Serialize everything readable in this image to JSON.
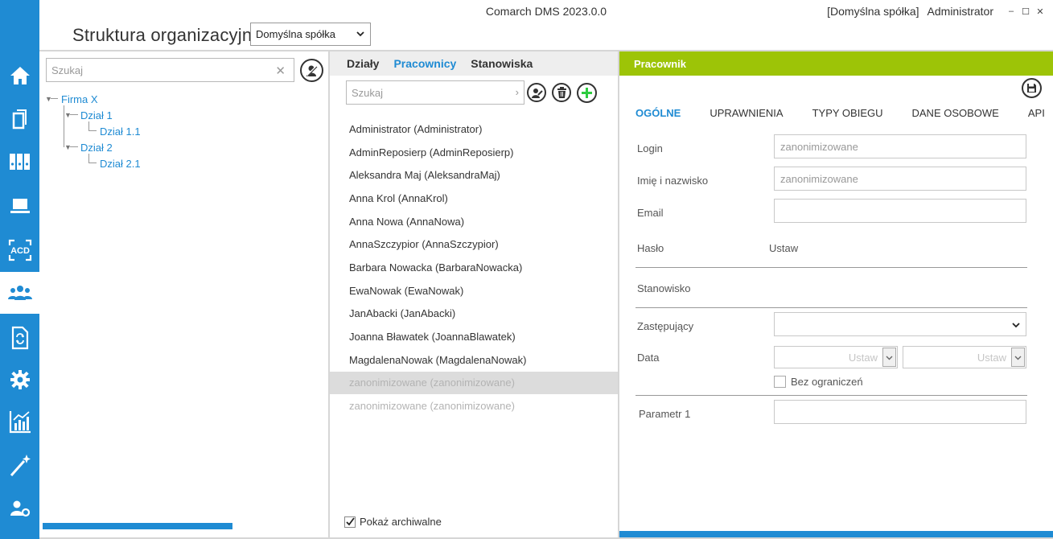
{
  "app": {
    "title": "Comarch DMS 2023.0.0",
    "company_label": "[Domyślna spółka]",
    "user": "Administrator"
  },
  "window_controls": {
    "minimize": "–",
    "maximize": "☐",
    "close": "✕"
  },
  "nav": {
    "items": [
      {
        "icon": "home-icon"
      },
      {
        "icon": "documents-icon"
      },
      {
        "icon": "binders-icon"
      },
      {
        "icon": "laptop-icon"
      },
      {
        "icon": "acd-icon",
        "label": "ACD"
      },
      {
        "icon": "users-icon",
        "active": true
      },
      {
        "icon": "document-workflow-icon"
      },
      {
        "icon": "gear-icon"
      },
      {
        "icon": "report-chart-icon"
      },
      {
        "icon": "magic-wand-icon"
      },
      {
        "icon": "user-settings-icon"
      }
    ]
  },
  "header": {
    "title": "Struktura organizacyjna",
    "company_select": "Domyślna spółka"
  },
  "left_panel": {
    "search_placeholder": "Szukaj",
    "tree": [
      {
        "label": "Firma X",
        "level": 0
      },
      {
        "label": "Dział 1",
        "level": 1
      },
      {
        "label": "Dział 1.1",
        "level": 2
      },
      {
        "label": "Dział 2",
        "level": 1
      },
      {
        "label": "Dział 2.1",
        "level": 2
      }
    ]
  },
  "mid_panel": {
    "tabs": [
      "Działy",
      "Pracownicy",
      "Stanowiska"
    ],
    "active_tab": "Pracownicy",
    "search_placeholder": "Szukaj",
    "employees": [
      "Administrator (Administrator)",
      "AdminReposierp (AdminReposierp)",
      "Aleksandra Maj (AleksandraMaj)",
      "Anna Krol (AnnaKrol)",
      "Anna Nowa (AnnaNowa)",
      "AnnaSzczypior (AnnaSzczypior)",
      "Barbara Nowacka (BarbaraNowacka)",
      "EwaNowak (EwaNowak)",
      "JanAbacki (JanAbacki)",
      "Joanna Bławatek (JoannaBlawatek)",
      "MagdalenaNowak (MagdalenaNowak)",
      "zanonimizowane (zanonimizowane)",
      "zanonimizowane (zanonimizowane)"
    ],
    "selected_index": 11,
    "archive_label": "Pokaż archiwalne",
    "archive_checked": true
  },
  "right_panel": {
    "title": "Pracownik",
    "tabs": [
      "OGÓLNE",
      "UPRAWNIENIA",
      "TYPY OBIEGU",
      "DANE OSOBOWE",
      "API"
    ],
    "active_tab": "OGÓLNE",
    "fields": {
      "login_label": "Login",
      "login_value": "zanonimizowane",
      "name_label": "Imię i nazwisko",
      "name_value": "zanonimizowane",
      "email_label": "Email",
      "email_value": "",
      "password_label": "Hasło",
      "password_action": "Ustaw",
      "position_label": "Stanowisko",
      "substitute_label": "Zastępujący",
      "date_label": "Data",
      "date_from": "Ustaw",
      "date_to": "Ustaw",
      "unlimited_label": "Bez ograniczeń",
      "unlimited_checked": false,
      "param1_label": "Parametr 1",
      "param1_value": ""
    }
  },
  "colors": {
    "accent": "#1f8bd3",
    "header_green": "#9dc407"
  }
}
